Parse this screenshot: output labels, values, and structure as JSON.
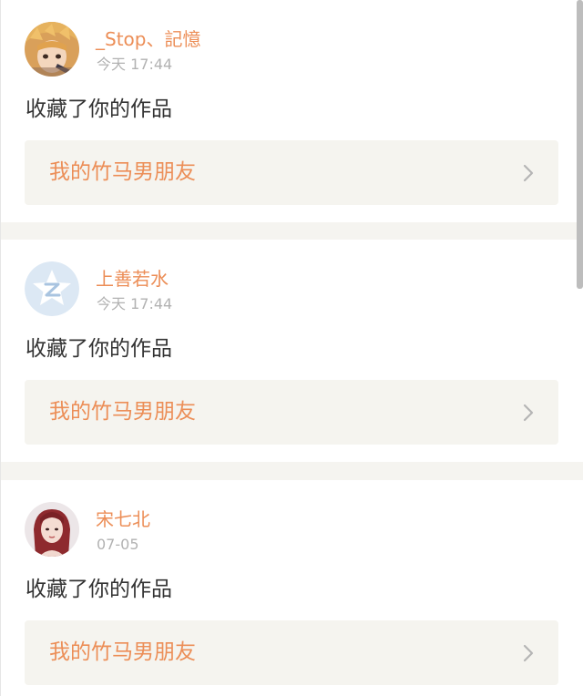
{
  "notifications": [
    {
      "user": "_Stop、記憶",
      "time": "今天 17:44",
      "action": "收藏了你的作品",
      "work_title": "我的竹马男朋友",
      "avatar": "anime-avatar"
    },
    {
      "user": "上善若水",
      "time": "今天 17:44",
      "action": "收藏了你的作品",
      "work_title": "我的竹马男朋友",
      "avatar": "default-qzone-avatar"
    },
    {
      "user": "宋七北",
      "time": "07-05",
      "action": "收藏了你的作品",
      "work_title": "我的竹马男朋友",
      "avatar": "portrait-avatar"
    }
  ],
  "colors": {
    "accent": "#ec8e57",
    "timestamp": "#b2b2b2",
    "body_text": "#333333",
    "link_bg": "#f5f4ef",
    "separator": "#f5f4f0"
  }
}
